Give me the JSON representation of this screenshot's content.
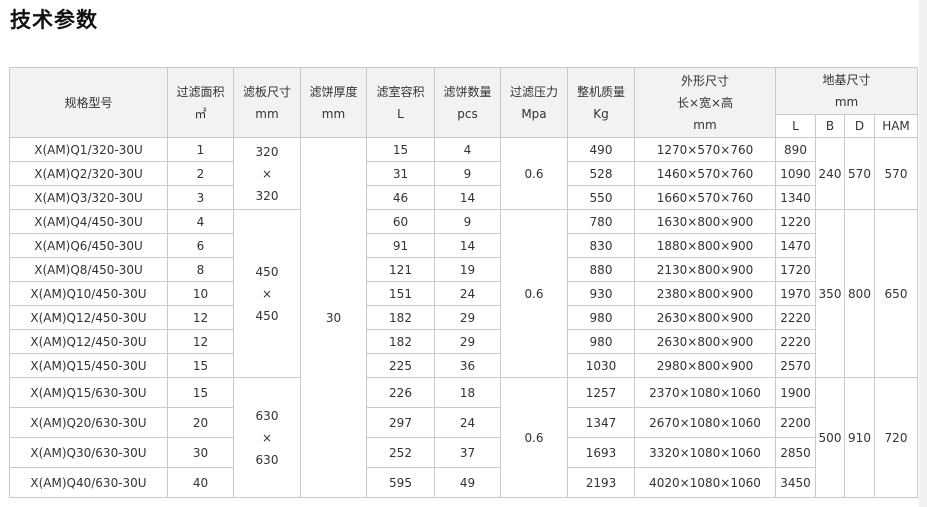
{
  "title": "技术参数",
  "headers": {
    "model": "规格型号",
    "area": [
      "过滤面积",
      "㎡"
    ],
    "plate": [
      "滤板尺寸",
      "mm"
    ],
    "thickness": [
      "滤饼厚度",
      "mm"
    ],
    "volume": [
      "滤室容积",
      "L"
    ],
    "cakes": [
      "滤饼数量",
      "pcs"
    ],
    "pressure": [
      "过滤压力",
      "Mpa"
    ],
    "mass": [
      "整机质量",
      "Kg"
    ],
    "dims": [
      "外形尺寸",
      "长×宽×高",
      "mm"
    ],
    "foundation": [
      "地基尺寸",
      "mm"
    ],
    "foundation_sub": [
      "L",
      "B",
      "D",
      "HAM"
    ]
  },
  "thickness_value": "30",
  "groups": [
    {
      "plate": [
        "320",
        "×",
        "320"
      ],
      "pressure": "0.6",
      "B": "240",
      "D": "570",
      "HAM": "570",
      "rows": [
        {
          "model": "X(AM)Q1/320-30U",
          "area": "1",
          "volume": "15",
          "cakes": "4",
          "mass": "490",
          "dims": "1270×570×760",
          "L": "890"
        },
        {
          "model": "X(AM)Q2/320-30U",
          "area": "2",
          "volume": "31",
          "cakes": "9",
          "mass": "528",
          "dims": "1460×570×760",
          "L": "1090"
        },
        {
          "model": "X(AM)Q3/320-30U",
          "area": "3",
          "volume": "46",
          "cakes": "14",
          "mass": "550",
          "dims": "1660×570×760",
          "L": "1340"
        }
      ]
    },
    {
      "plate": [
        "450",
        "×",
        "450"
      ],
      "pressure": "0.6",
      "B": "350",
      "D": "800",
      "HAM": "650",
      "rows": [
        {
          "model": "X(AM)Q4/450-30U",
          "area": "4",
          "volume": "60",
          "cakes": "9",
          "mass": "780",
          "dims": "1630×800×900",
          "L": "1220"
        },
        {
          "model": "X(AM)Q6/450-30U",
          "area": "6",
          "volume": "91",
          "cakes": "14",
          "mass": "830",
          "dims": "1880×800×900",
          "L": "1470"
        },
        {
          "model": "X(AM)Q8/450-30U",
          "area": "8",
          "volume": "121",
          "cakes": "19",
          "mass": "880",
          "dims": "2130×800×900",
          "L": "1720"
        },
        {
          "model": "X(AM)Q10/450-30U",
          "area": "10",
          "volume": "151",
          "cakes": "24",
          "mass": "930",
          "dims": "2380×800×900",
          "L": "1970"
        },
        {
          "model": "X(AM)Q12/450-30U",
          "area": "12",
          "volume": "182",
          "cakes": "29",
          "mass": "980",
          "dims": "2630×800×900",
          "L": "2220"
        },
        {
          "model": "X(AM)Q12/450-30U",
          "area": "12",
          "volume": "182",
          "cakes": "29",
          "mass": "980",
          "dims": "2630×800×900",
          "L": "2220"
        },
        {
          "model": "X(AM)Q15/450-30U",
          "area": "15",
          "volume": "225",
          "cakes": "36",
          "mass": "1030",
          "dims": "2980×800×900",
          "L": "2570"
        }
      ]
    },
    {
      "plate": [
        "630",
        "×",
        "630"
      ],
      "pressure": "0.6",
      "B": "500",
      "D": "910",
      "HAM": "720",
      "rows": [
        {
          "model": "X(AM)Q15/630-30U",
          "area": "15",
          "volume": "226",
          "cakes": "18",
          "mass": "1257",
          "dims": "2370×1080×1060",
          "L": "1900"
        },
        {
          "model": "X(AM)Q20/630-30U",
          "area": "20",
          "volume": "297",
          "cakes": "24",
          "mass": "1347",
          "dims": "2670×1080×1060",
          "L": "2200"
        },
        {
          "model": "X(AM)Q30/630-30U",
          "area": "30",
          "volume": "252",
          "cakes": "37",
          "mass": "1693",
          "dims": "3320×1080×1060",
          "L": "2850"
        },
        {
          "model": "X(AM)Q40/630-30U",
          "area": "40",
          "volume": "595",
          "cakes": "49",
          "mass": "2193",
          "dims": "4020×1080×1060",
          "L": "3450"
        }
      ]
    }
  ]
}
